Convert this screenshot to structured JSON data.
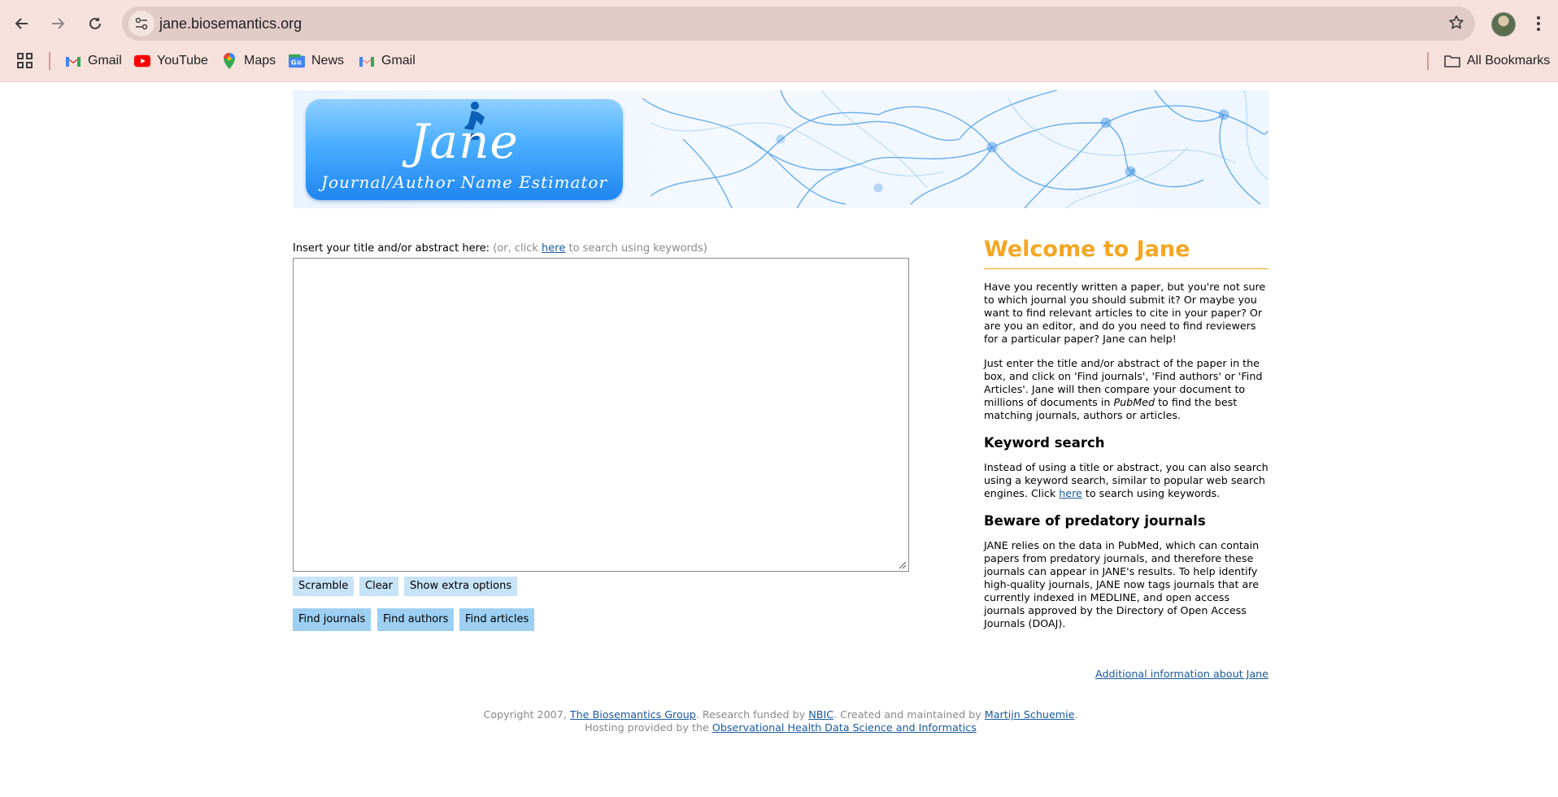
{
  "browser": {
    "url": "jane.biosemantics.org",
    "bookmarks": [
      {
        "label": "Gmail",
        "icon": "gmail-icon"
      },
      {
        "label": "YouTube",
        "icon": "youtube-icon"
      },
      {
        "label": "Maps",
        "icon": "maps-icon"
      },
      {
        "label": "News",
        "icon": "news-icon"
      },
      {
        "label": "Gmail",
        "icon": "gmail-icon"
      }
    ],
    "all_bookmarks": "All Bookmarks"
  },
  "banner": {
    "logo_title": "Jane",
    "logo_subtitle": "Journal/Author Name Estimator"
  },
  "form": {
    "label": "Insert your title and/or abstract here:",
    "hint_prefix": "(or, click",
    "hint_link": "here",
    "hint_suffix": "to search using keywords)",
    "buttons_row1": [
      "Scramble",
      "Clear",
      "Show extra options"
    ],
    "buttons_row2": [
      "Find journals",
      "Find authors",
      "Find articles"
    ]
  },
  "sidebar": {
    "title": "Welcome to Jane",
    "intro": "Have you recently written a paper, but you're not sure to which journal you should submit it? Or maybe you want to find relevant articles to cite in your paper? Or are you an editor, and do you need to find reviewers for a particular paper? Jane can help!",
    "instructions_part1": "Just enter the title and/or abstract of the paper in the box, and click on 'Find journals', 'Find authors' or 'Find Articles'. Jane will then compare your document to millions of documents in",
    "instructions_em": "PubMed",
    "instructions_part2": "to find the best matching journals, authors or articles.",
    "keyword_heading": "Keyword search",
    "keyword_part1": "Instead of using a title or abstract, you can also search using a keyword search, similar to popular web search engines. Click",
    "keyword_link": "here",
    "keyword_part2": "to search using keywords.",
    "predatory_heading": "Beware of predatory journals",
    "predatory_text": "JANE relies on the data in PubMed, which can contain papers from predatory journals, and therefore these journals can appear in JANE's results. To help identify high-quality journals, JANE now tags journals that are currently indexed in MEDLINE, and open access journals approved by the Directory of Open Access Journals (DOAJ).",
    "additional_link": "Additional information about Jane"
  },
  "footer": {
    "copyright": "Copyright 2007,",
    "group_link": "The Biosemantics Group",
    "funded": ". Research funded by",
    "nbic_link": "NBIC",
    "maintained": ". Created and maintained by",
    "author_link": "Martijn Schuemie",
    "period": ".",
    "hosting": "Hosting provided by the",
    "ohdsi_link": "Observational Health Data Science and Informatics"
  },
  "colors": {
    "accent_orange": "#f5a623",
    "button_light": "#c7e3f7",
    "button_dark": "#9ccff2",
    "link": "#1a5aa0",
    "chrome_bg": "#f6e1dc"
  }
}
